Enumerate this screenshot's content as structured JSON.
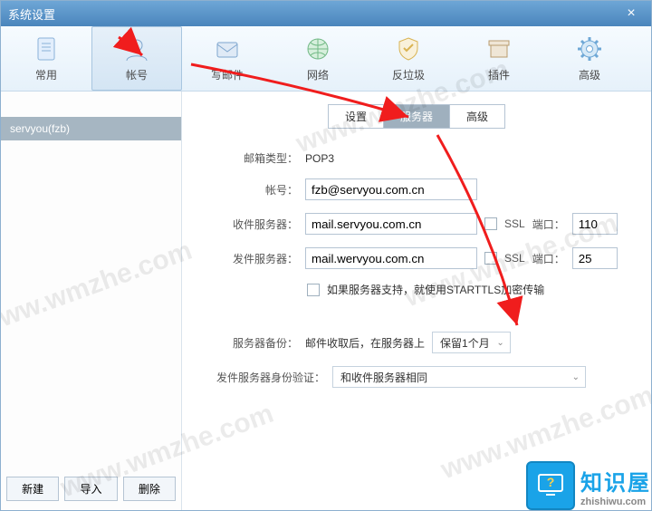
{
  "window": {
    "title": "系统设置"
  },
  "toolbar": {
    "items": [
      {
        "label": "常用"
      },
      {
        "label": "帐号"
      },
      {
        "label": "写邮件"
      },
      {
        "label": "网络"
      },
      {
        "label": "反垃圾"
      },
      {
        "label": "插件"
      },
      {
        "label": "高级"
      }
    ],
    "selected_index": 1
  },
  "sidebar": {
    "accounts": [
      {
        "label": "servyou(fzb)"
      }
    ],
    "buttons": {
      "new": "新建",
      "import": "导入",
      "delete": "删除"
    }
  },
  "tabs": {
    "items": [
      "设置",
      "服务器",
      "高级"
    ],
    "selected_index": 1
  },
  "form": {
    "mailbox_type_label": "邮箱类型：",
    "mailbox_type_value": "POP3",
    "account_label": "帐号：",
    "account_value": "fzb@servyou.com.cn",
    "incoming_label": "收件服务器：",
    "incoming_value": "mail.servyou.com.cn",
    "outgoing_label": "发件服务器：",
    "outgoing_value": "mail.wervyou.com.cn",
    "ssl_label": "SSL",
    "port_label": "端口：",
    "incoming_port": "110",
    "outgoing_port": "25",
    "starttls_label": "如果服务器支持，就使用STARTTLS加密传输",
    "backup_label": "服务器备份：",
    "backup_text": "邮件收取后，在服务器上",
    "backup_option": "保留1个月",
    "auth_label": "发件服务器身份验证：",
    "auth_option": "和收件服务器相同"
  },
  "brand": {
    "name": "知识屋",
    "domain": "zhishiwu.com"
  },
  "watermark": "www.wmzhe.com"
}
